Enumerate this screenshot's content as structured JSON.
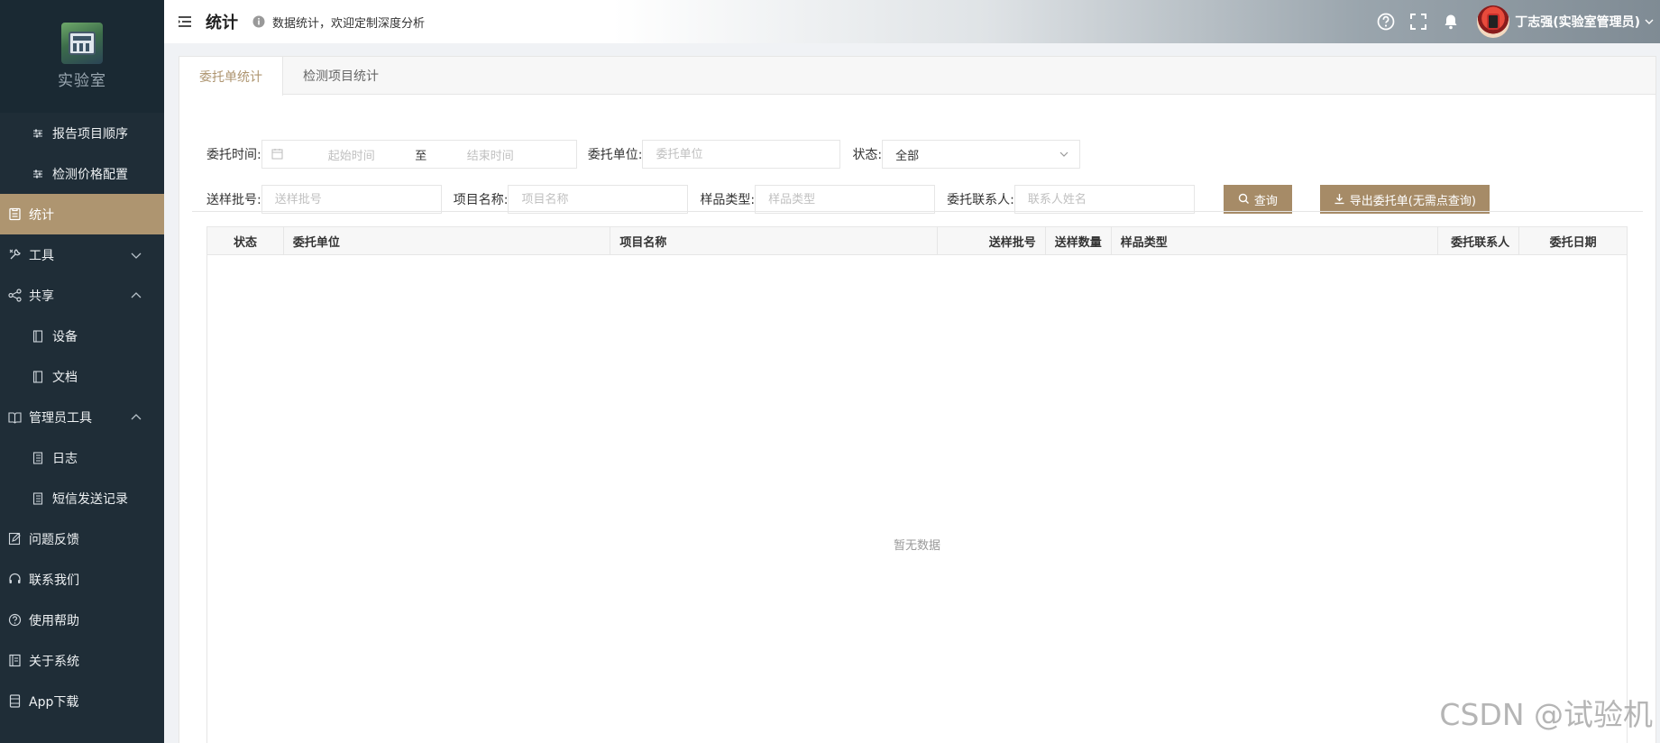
{
  "sidebar": {
    "logo_text": "实验室",
    "items": [
      {
        "label": "报告项目顺序",
        "icon": "sliders-icon",
        "sub": true
      },
      {
        "label": "检测价格配置",
        "icon": "sliders-icon",
        "sub": true
      },
      {
        "label": "统计",
        "icon": "chart-doc-icon",
        "active": true
      },
      {
        "label": "工具",
        "icon": "tools-icon",
        "chevron": "down"
      },
      {
        "label": "共享",
        "icon": "share-icon",
        "chevron": "up"
      },
      {
        "label": "设备",
        "icon": "device-icon",
        "sub": true
      },
      {
        "label": "文档",
        "icon": "document-icon",
        "sub": true
      },
      {
        "label": "管理员工具",
        "icon": "book-icon",
        "chevron": "up"
      },
      {
        "label": "日志",
        "icon": "log-icon",
        "sub": true
      },
      {
        "label": "短信发送记录",
        "icon": "log-icon",
        "sub": true
      },
      {
        "label": "问题反馈",
        "icon": "feedback-icon"
      },
      {
        "label": "联系我们",
        "icon": "headset-icon"
      },
      {
        "label": "使用帮助",
        "icon": "help-icon"
      },
      {
        "label": "关于系统",
        "icon": "about-icon"
      },
      {
        "label": "App下载",
        "icon": "app-icon"
      }
    ]
  },
  "header": {
    "title": "统计",
    "description": "数据统计，欢迎定制深度分析",
    "user_name": "丁志强(实验室管理员)"
  },
  "tabs": [
    {
      "label": "委托单统计",
      "active": true
    },
    {
      "label": "检测项目统计",
      "active": false
    }
  ],
  "filters": {
    "time_label": "委托时间:",
    "start_placeholder": "起始时间",
    "range_separator": "至",
    "end_placeholder": "结束时间",
    "unit_label": "委托单位:",
    "unit_placeholder": "委托单位",
    "status_label": "状态:",
    "status_value": "全部",
    "batch_label": "送样批号:",
    "batch_placeholder": "送样批号",
    "project_label": "项目名称:",
    "project_placeholder": "项目名称",
    "sample_label": "样品类型:",
    "sample_placeholder": "样品类型",
    "contact_label": "委托联系人:",
    "contact_placeholder": "联系人姓名",
    "search_button": "查询",
    "export_button": "导出委托单(无需点查询)"
  },
  "table": {
    "columns": [
      "状态",
      "委托单位",
      "项目名称",
      "送样批号",
      "送样数量",
      "样品类型",
      "委托联系人",
      "委托日期"
    ],
    "empty_text": "暂无数据"
  },
  "watermark": "CSDN @试验机",
  "colors": {
    "sidebar_bg": "#1f2d37",
    "accent": "#ae9570",
    "button": "#a68b67"
  }
}
